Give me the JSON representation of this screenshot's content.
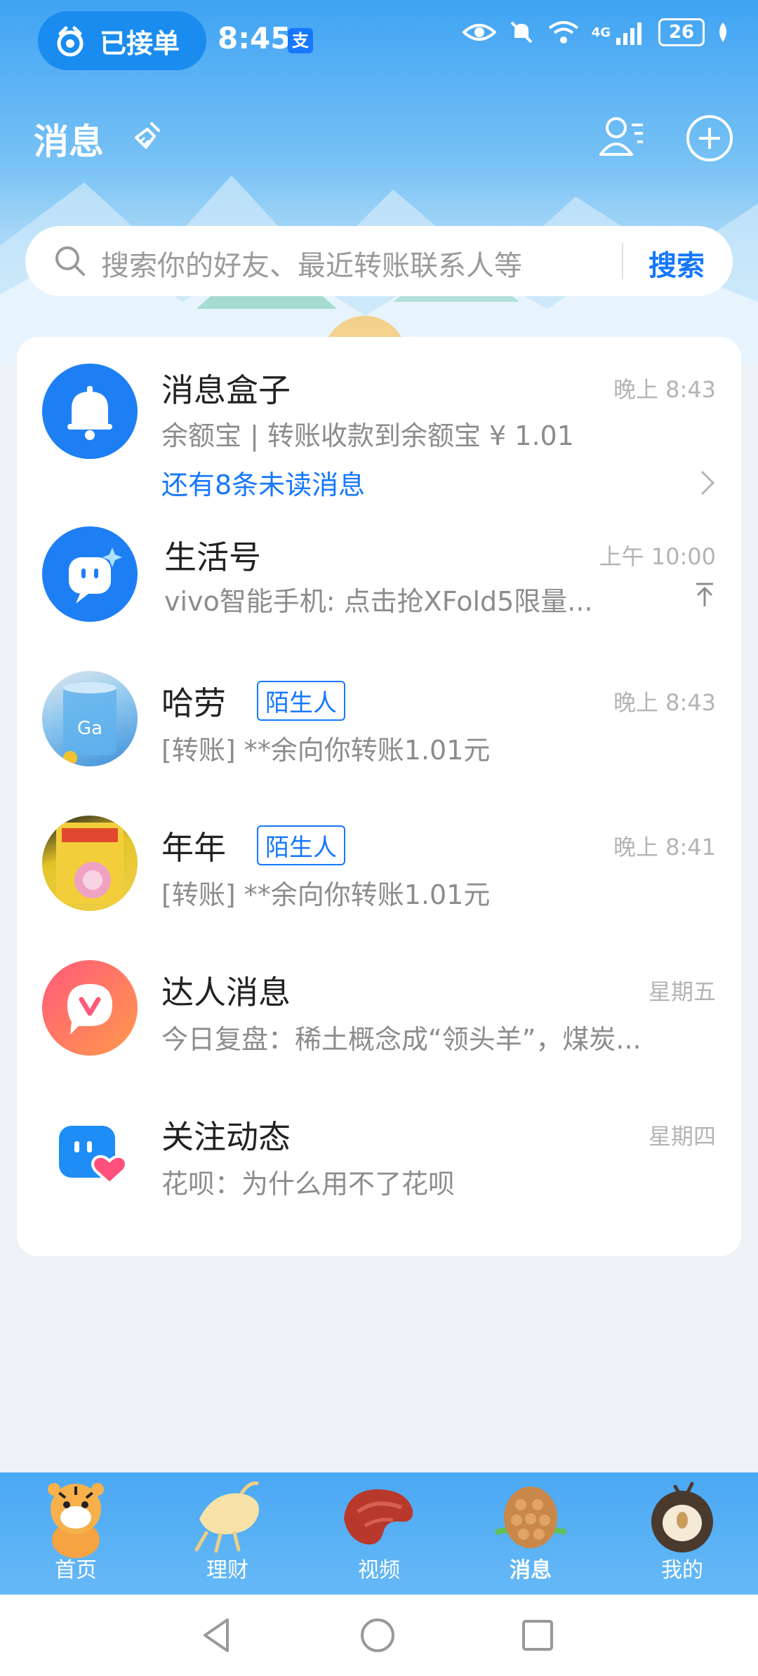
{
  "status_bar": {
    "pill_label": "已接单",
    "time": "8:45",
    "alipay_badge": "支",
    "battery": "26",
    "network": "4G"
  },
  "header": {
    "title": "消息",
    "search_placeholder": "搜索你的好友、最近转账联系人等",
    "search_button": "搜索"
  },
  "messages": [
    {
      "name": "消息盒子",
      "time": "晚上 8:43",
      "preview": "余额宝 | 转账收款到余额宝 ¥ 1.01",
      "unread": "还有8条未读消息",
      "avatar": "bell-icon"
    },
    {
      "name": "生活号",
      "time": "上午 10:00",
      "preview": "vivo智能手机: 点击抢XFold5限量...",
      "avatar": "life-account-icon"
    },
    {
      "name": "哈劳",
      "tag": "陌生人",
      "time": "晚上 8:43",
      "preview": "[转账] **余向你转账1.01元",
      "avatar": "photo-avatar"
    },
    {
      "name": "年年",
      "tag": "陌生人",
      "time": "晚上 8:41",
      "preview": "[转账] **余向你转账1.01元",
      "avatar": "photo-avatar"
    },
    {
      "name": "达人消息",
      "time": "星期五",
      "preview": "今日复盘：稀土概念成“领头羊”，煤炭...",
      "avatar": "v-chat-icon"
    },
    {
      "name": "关注动态",
      "time": "星期四",
      "preview": "花呗：为什么用不了花呗",
      "avatar": "follow-heart-icon"
    }
  ],
  "tabs": [
    {
      "label": "首页",
      "icon": "tiger-icon",
      "active": false
    },
    {
      "label": "理财",
      "icon": "ginseng-icon",
      "active": false
    },
    {
      "label": "视频",
      "icon": "mushroom-icon",
      "active": false
    },
    {
      "label": "消息",
      "icon": "pinecone-icon",
      "active": true
    },
    {
      "label": "我的",
      "icon": "fruit-icon",
      "active": false
    }
  ],
  "colors": {
    "accent": "#1677ff",
    "header_top": "#3fa3f3",
    "tab_bar": "#4aa8f3"
  }
}
